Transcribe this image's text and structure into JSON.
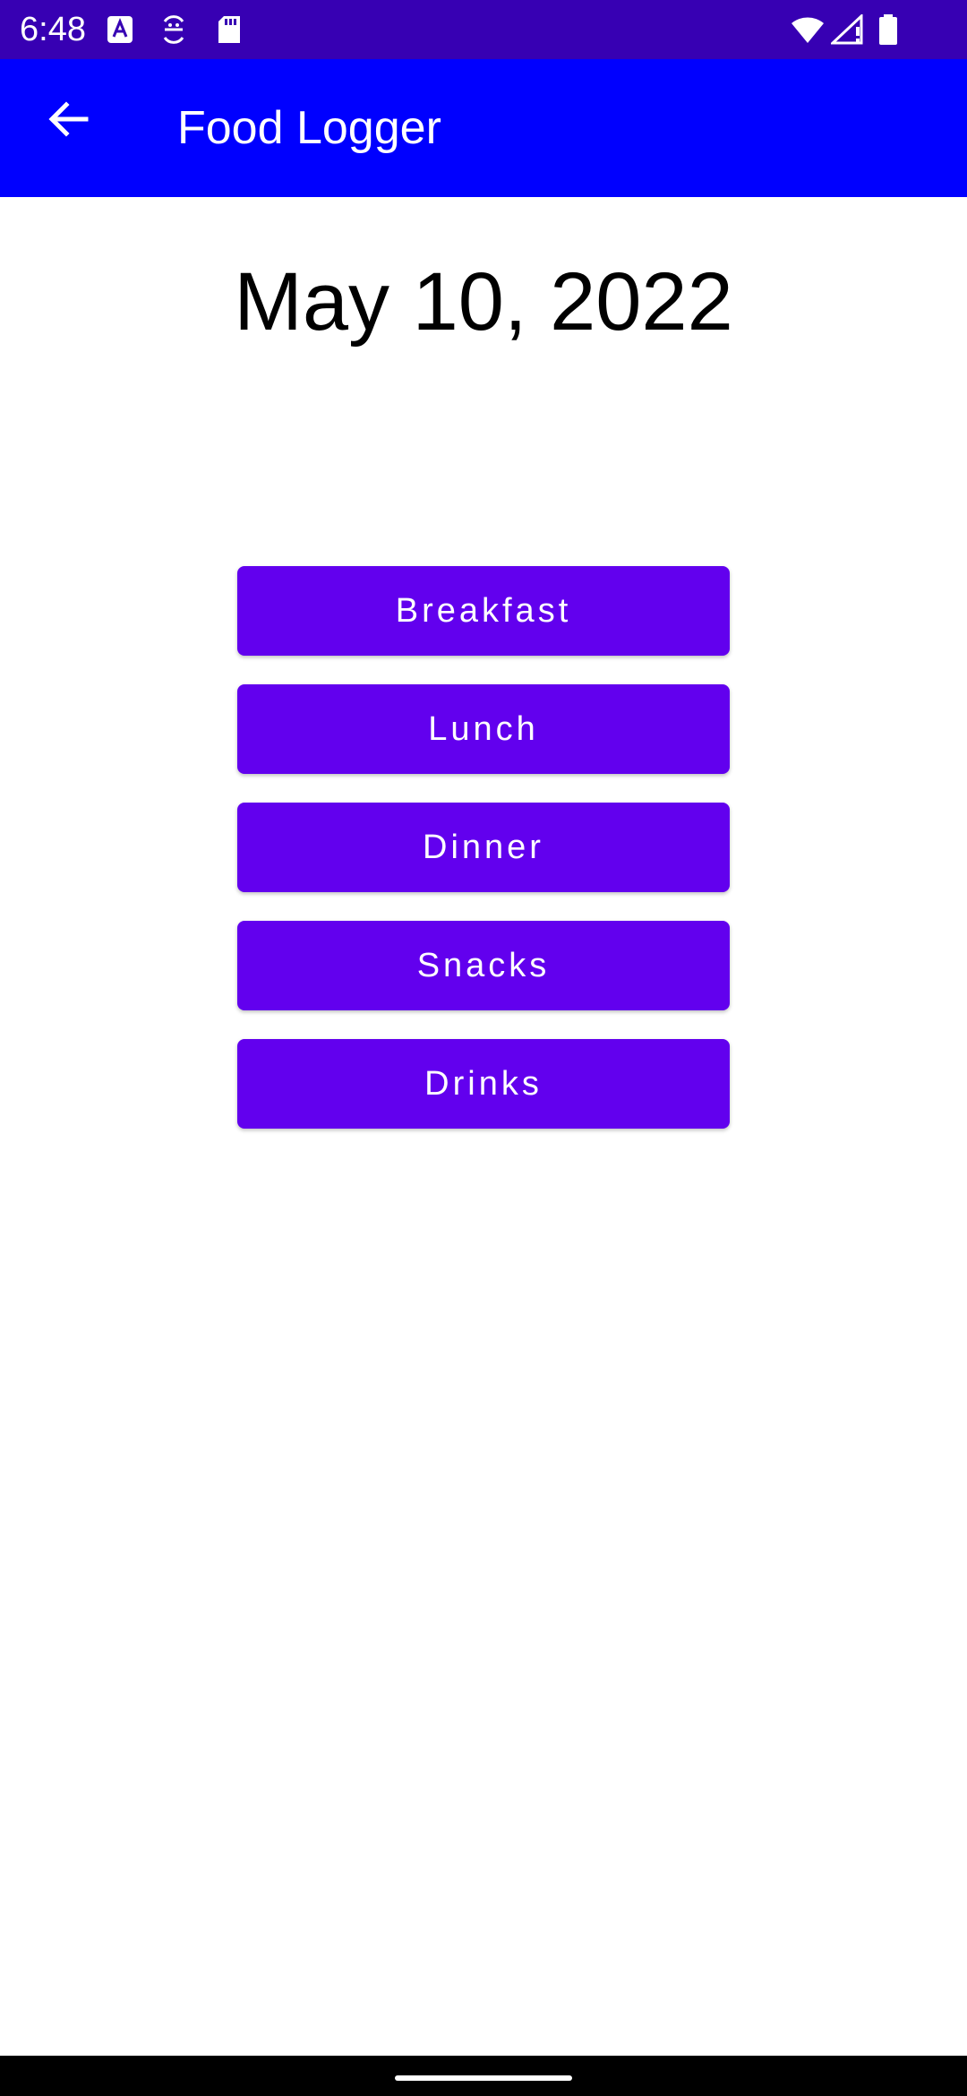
{
  "status_bar": {
    "time": "6:48",
    "left_icons": [
      "font-a-icon",
      "sync-smile-icon",
      "sd-card-icon"
    ],
    "right_icons": [
      "wifi-icon",
      "signal-icon",
      "battery-icon"
    ],
    "background": "#3700b3"
  },
  "app_bar": {
    "title": "Food Logger",
    "back_icon": "arrow-back-icon",
    "background": "#0000ff"
  },
  "main": {
    "date": "May 10, 2022",
    "meal_buttons": [
      {
        "label": "Breakfast"
      },
      {
        "label": "Lunch"
      },
      {
        "label": "Dinner"
      },
      {
        "label": "Snacks"
      },
      {
        "label": "Drinks"
      }
    ],
    "button_color": "#6200ee"
  }
}
